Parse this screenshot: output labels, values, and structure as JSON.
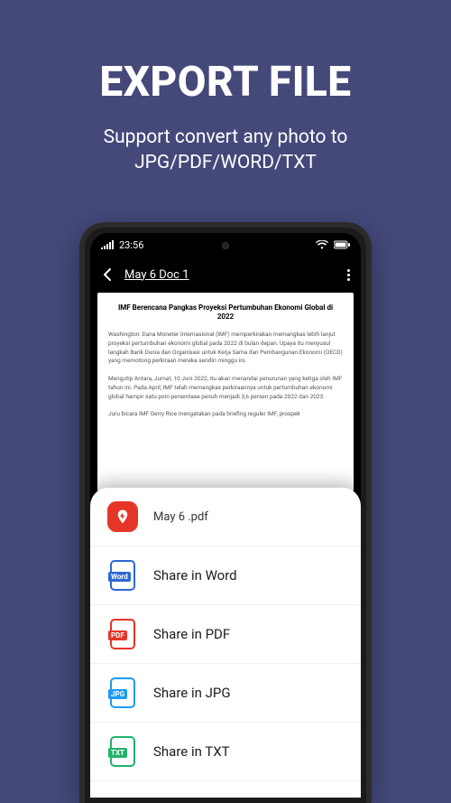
{
  "hero": {
    "title": "EXPORT FILE",
    "subtitle_line1": "Support convert any photo to",
    "subtitle_line2": "JPG/PDF/WORD/TXT"
  },
  "status": {
    "time": "23:56"
  },
  "header": {
    "doc_title": "May 6  Doc 1"
  },
  "document": {
    "heading": "IMF Berencana Pangkas Proyeksi Pertumbuhan Ekonomi Global di 2022",
    "para1": "Washington: Dana Moneter Internasional (IMF) memperkirakan memangkas lebih lanjut proyeksi pertumbuhan ekonomi global pada 2022 di bulan depan. Upaya itu menyusul langkah Bank Dunia dan Organisasi untuk Kerja Sama dan Pembangunan Ekonomi (OECD) yang memotong perkiraan mereka sendiri minggu ini.",
    "para2": "Mengutip Antara, Jumat, 10 Juni 2022, itu akan menandai penurunan yang ketiga oleh IMF tahun ini. Pada April, IMF telah memangkas perkiraannya untuk pertumbuhan ekonomi global hampir satu poin persentase penuh menjadi 3,6 persen pada 2022 dan 2023.",
    "para3": "Juru bicara IMF Gerry Rice mengatakan pada briefing reguler IMF, prospek"
  },
  "sheet": {
    "filename": "May 6 .pdf",
    "options": [
      {
        "id": "word",
        "label": "Share in Word",
        "tag": "Word"
      },
      {
        "id": "pdf",
        "label": "Share in PDF",
        "tag": "PDF"
      },
      {
        "id": "jpg",
        "label": "Share in JPG",
        "tag": "JPG"
      },
      {
        "id": "txt",
        "label": "Share in TXT",
        "tag": "TXT"
      }
    ]
  }
}
